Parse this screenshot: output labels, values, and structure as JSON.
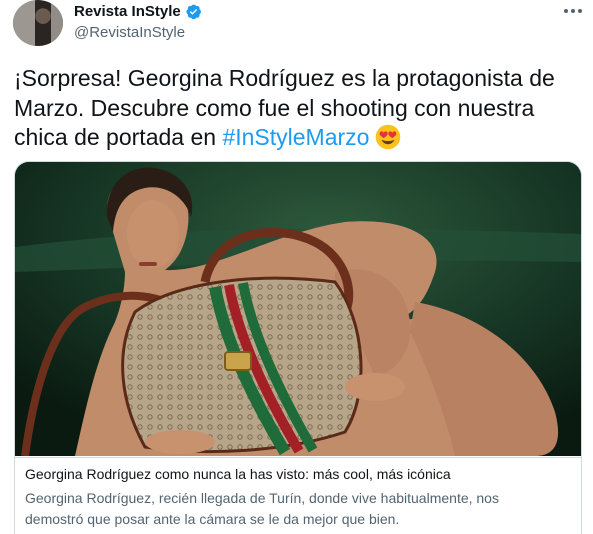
{
  "account": {
    "display_name": "Revista InStyle",
    "handle": "@RevistaInStyle",
    "verified_color": "#1d9bf0"
  },
  "tweet": {
    "text": "¡Sorpresa! Georgina Rodríguez es la protagonista de Marzo. Descubre como fue el shooting con nuestra chica de portada en ",
    "hashtag": "#InStyleMarzo",
    "emoji": "heart-eyes-emoji",
    "hashtag_color": "#1d9bf0"
  },
  "link_card": {
    "image": "photo-woman-with-patterned-handbag",
    "title": "Georgina Rodríguez como nunca la has visto: más cool, más icónica",
    "description": "Georgina Rodríguez, recién llegada de Turín, donde vive habitualmente, nos demostró que posar ante la cámara se le da mejor que bien."
  },
  "icons": [
    "verified-badge-icon",
    "more-options-icon"
  ]
}
